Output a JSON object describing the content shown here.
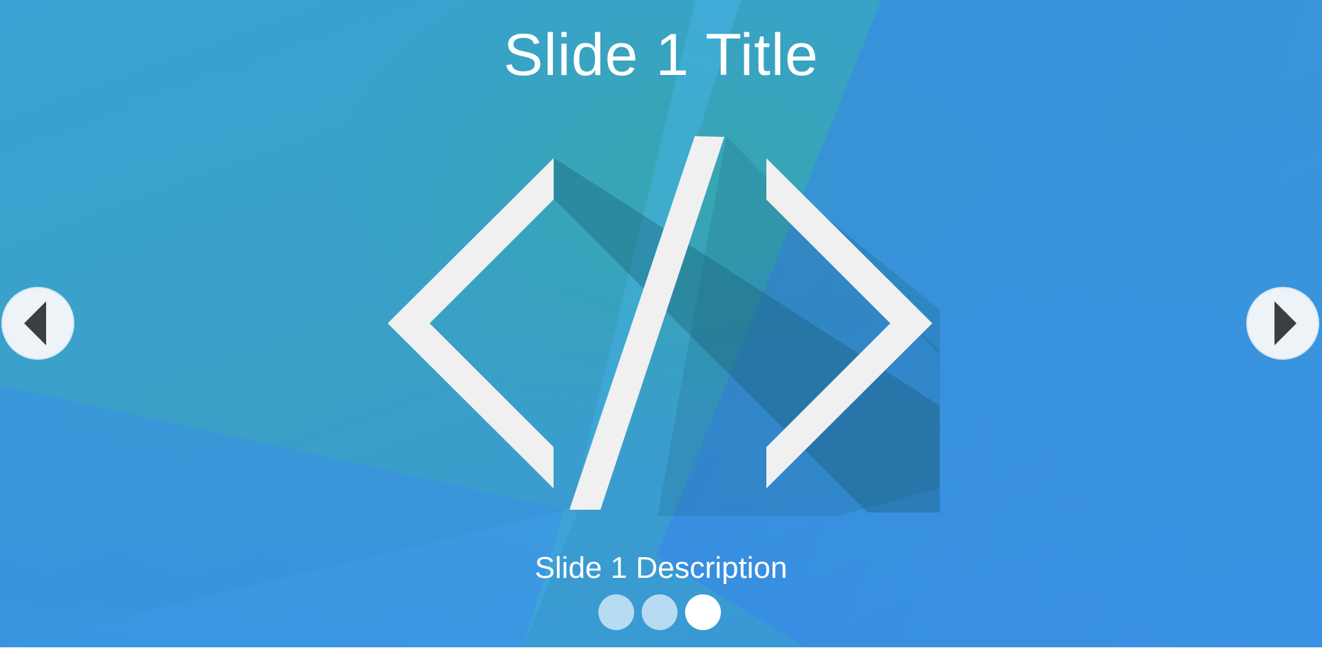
{
  "slider": {
    "slide_title": "Slide 1 Title",
    "slide_description": "Slide 1 Description",
    "image_icon": "code-brackets-icon",
    "prev_icon": "triangle-left-icon",
    "next_icon": "triangle-right-icon",
    "dots": [
      {
        "active": false
      },
      {
        "active": false
      },
      {
        "active": true
      }
    ],
    "colors": {
      "background": "#38a3d2",
      "glyph": "#f0f0f0",
      "nav_button": "#eef3f8",
      "nav_arrow": "#3a3f44"
    }
  }
}
